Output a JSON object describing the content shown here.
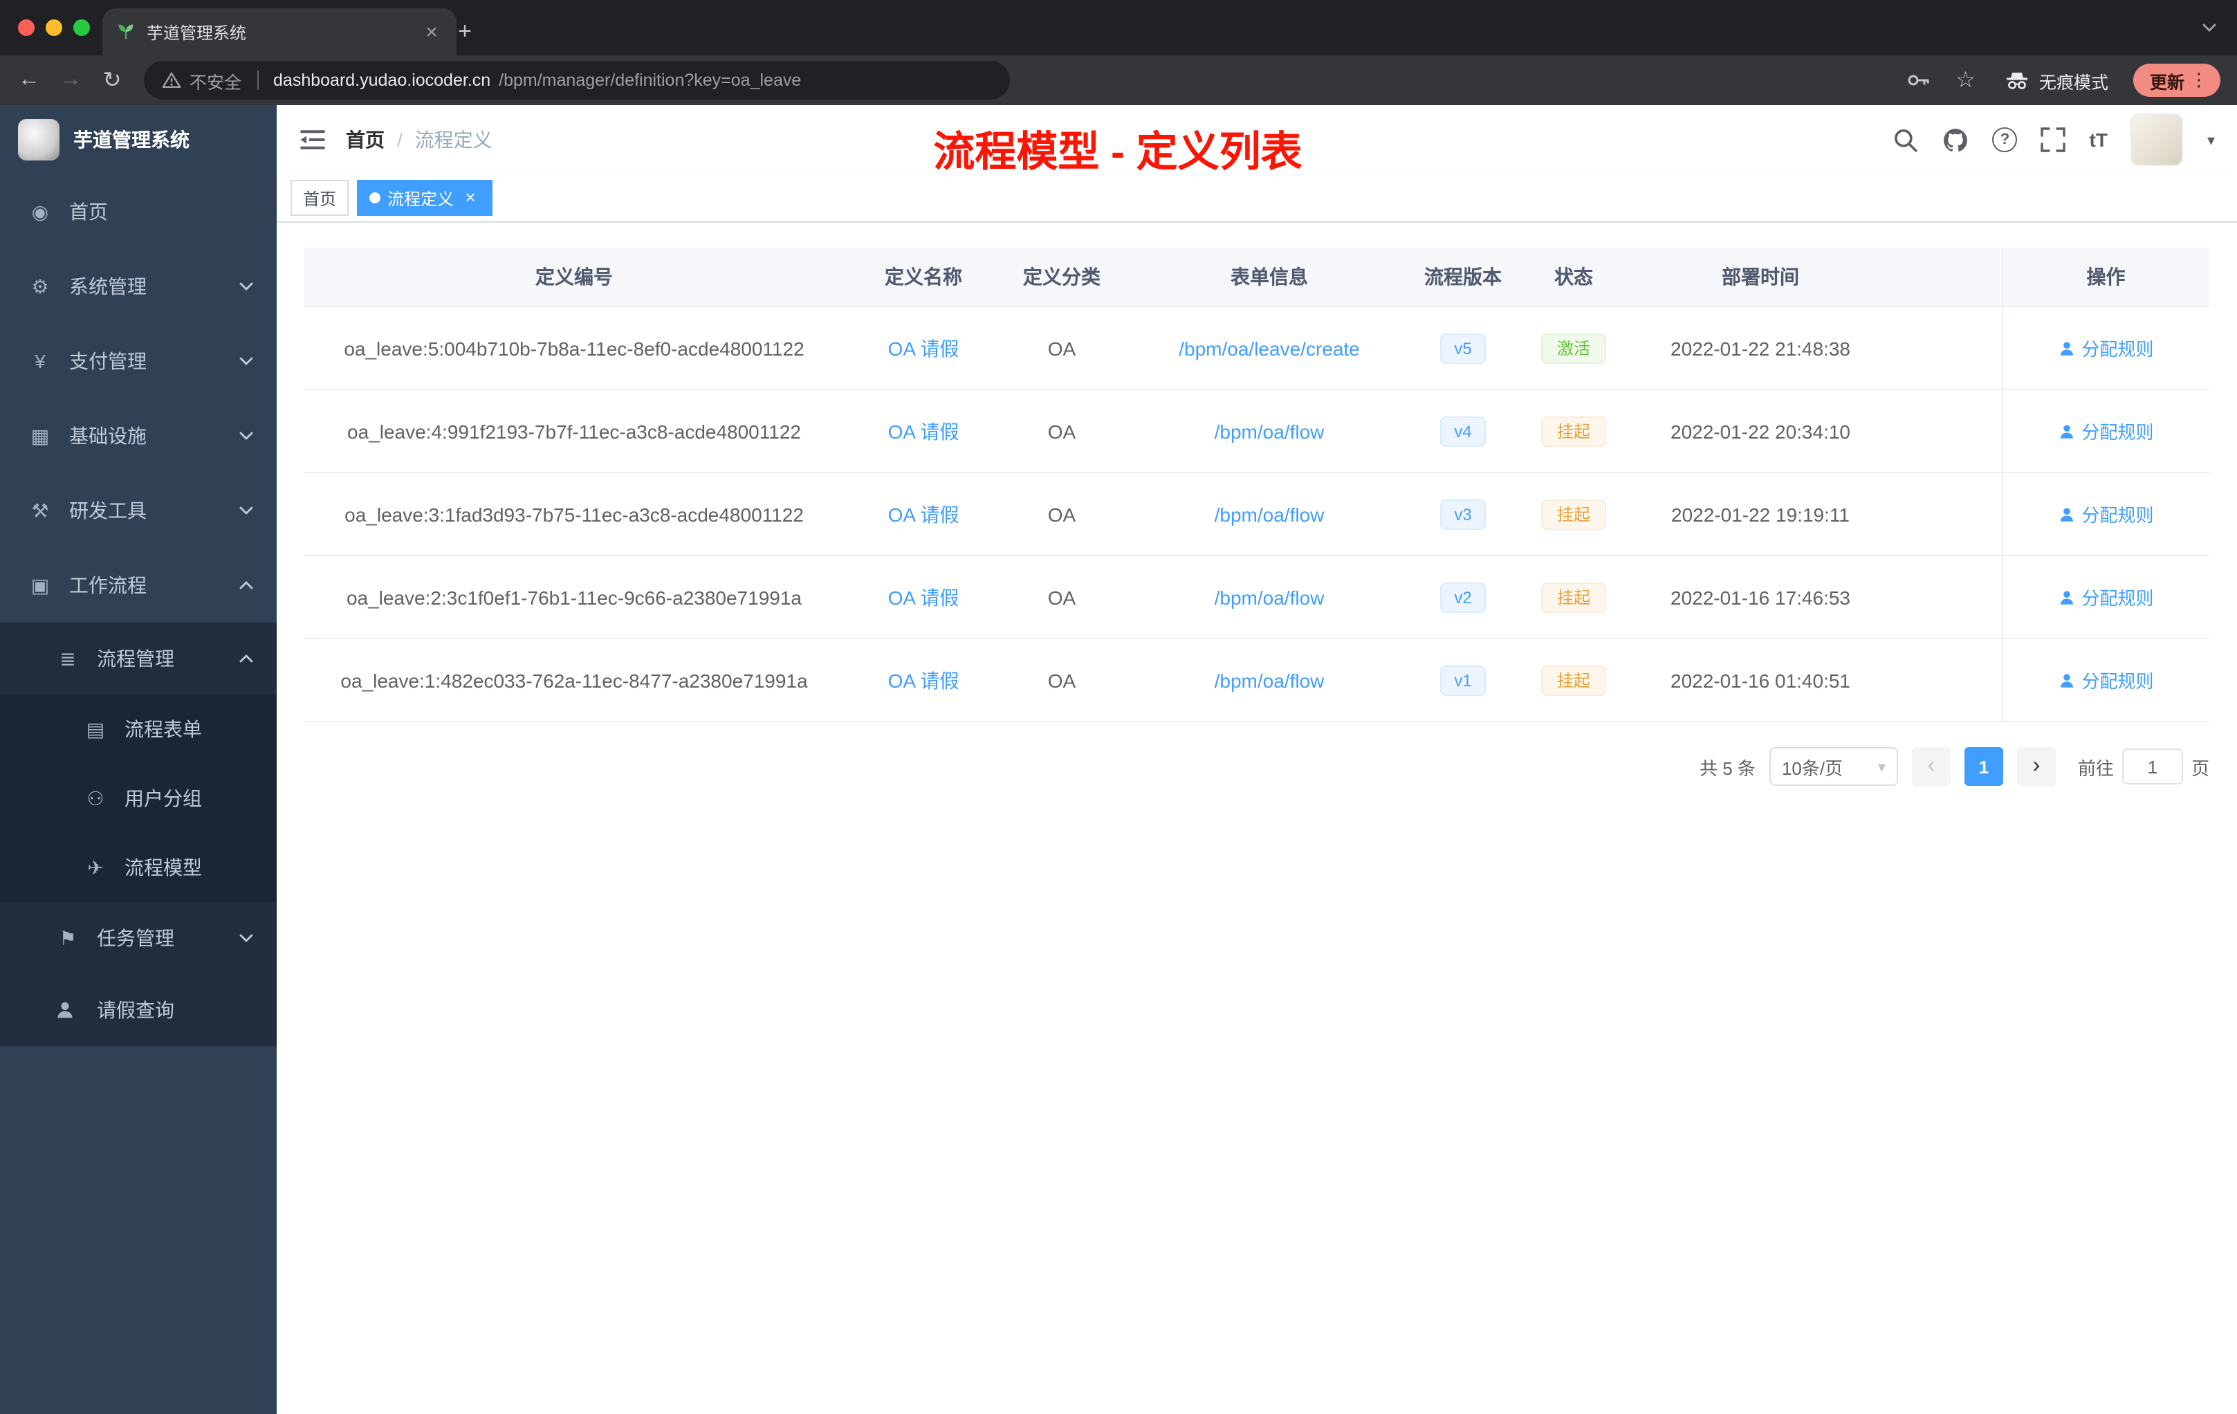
{
  "browser": {
    "tab_title": "芋道管理系统",
    "security_label": "不安全",
    "url_domain": "dashboard.yudao.iocoder.cn",
    "url_path": "/bpm/manager/definition?key=oa_leave",
    "incognito_label": "无痕模式",
    "update_label": "更新"
  },
  "icons": {
    "close": "×",
    "plus": "+",
    "back": "←",
    "forward": "→",
    "reload": "↻",
    "star": "☆",
    "kebab": "⋮",
    "question": "?",
    "font_size": "tT",
    "caret_down": "▾",
    "prev": "‹",
    "next": "›"
  },
  "sidebar": {
    "logo_title": "芋道管理系统",
    "items": [
      {
        "label": "首页",
        "glyph": "◉",
        "level": 1,
        "arrow": ""
      },
      {
        "label": "系统管理",
        "glyph": "⚙",
        "level": 1,
        "arrow": "down"
      },
      {
        "label": "支付管理",
        "glyph": "¥",
        "level": 1,
        "arrow": "down"
      },
      {
        "label": "基础设施",
        "glyph": "▦",
        "level": 1,
        "arrow": "down"
      },
      {
        "label": "研发工具",
        "glyph": "⚒",
        "level": 1,
        "arrow": "down"
      },
      {
        "label": "工作流程",
        "glyph": "▣",
        "level": 1,
        "arrow": "up"
      },
      {
        "label": "流程管理",
        "glyph": "≣",
        "level": 2,
        "arrow": "up"
      },
      {
        "label": "流程表单",
        "glyph": "▤",
        "level": 3,
        "arrow": ""
      },
      {
        "label": "用户分组",
        "glyph": "⚇",
        "level": 3,
        "arrow": ""
      },
      {
        "label": "流程模型",
        "glyph": "✈",
        "level": 3,
        "arrow": ""
      },
      {
        "label": "任务管理",
        "glyph": "⚑",
        "level": 2,
        "arrow": "down"
      },
      {
        "label": "请假查询",
        "glyph": "",
        "level": 2,
        "arrow": ""
      }
    ]
  },
  "header": {
    "breadcrumb_home": "首页",
    "breadcrumb_separator": "/",
    "breadcrumb_current": "流程定义",
    "annotation": "流程模型 - 定义列表"
  },
  "tags": [
    {
      "label": "首页",
      "active": false
    },
    {
      "label": "流程定义",
      "active": true
    }
  ],
  "table": {
    "columns": [
      "定义编号",
      "定义名称",
      "定义分类",
      "表单信息",
      "流程版本",
      "状态",
      "部署时间",
      "操作"
    ],
    "action_label": "分配规则",
    "rows": [
      {
        "id": "oa_leave:5:004b710b-7b8a-11ec-8ef0-acde48001122",
        "name": "OA 请假",
        "category": "OA",
        "form": "/bpm/oa/leave/create",
        "version": "v5",
        "status": "激活",
        "status_type": "success",
        "time": "2022-01-22 21:48:38"
      },
      {
        "id": "oa_leave:4:991f2193-7b7f-11ec-a3c8-acde48001122",
        "name": "OA 请假",
        "category": "OA",
        "form": "/bpm/oa/flow",
        "version": "v4",
        "status": "挂起",
        "status_type": "warning",
        "time": "2022-01-22 20:34:10"
      },
      {
        "id": "oa_leave:3:1fad3d93-7b75-11ec-a3c8-acde48001122",
        "name": "OA 请假",
        "category": "OA",
        "form": "/bpm/oa/flow",
        "version": "v3",
        "status": "挂起",
        "status_type": "warning",
        "time": "2022-01-22 19:19:11"
      },
      {
        "id": "oa_leave:2:3c1f0ef1-76b1-11ec-9c66-a2380e71991a",
        "name": "OA 请假",
        "category": "OA",
        "form": "/bpm/oa/flow",
        "version": "v2",
        "status": "挂起",
        "status_type": "warning",
        "time": "2022-01-16 17:46:53"
      },
      {
        "id": "oa_leave:1:482ec033-762a-11ec-8477-a2380e71991a",
        "name": "OA 请假",
        "category": "OA",
        "form": "/bpm/oa/flow",
        "version": "v1",
        "status": "挂起",
        "status_type": "warning",
        "time": "2022-01-16 01:40:51"
      }
    ]
  },
  "pagination": {
    "total": "共 5 条",
    "page_size": "10条/页",
    "current": "1",
    "goto_label": "前往",
    "goto_value": "1",
    "page_unit": "页"
  },
  "colors": {
    "accent": "#409eff",
    "success": "#67c23a",
    "warning": "#e6a23c",
    "sidebar_bg": "#304156",
    "submenu_bg": "#1f2d3d",
    "annotation_red": "#fb1505",
    "update_badge": "#f28b82"
  }
}
